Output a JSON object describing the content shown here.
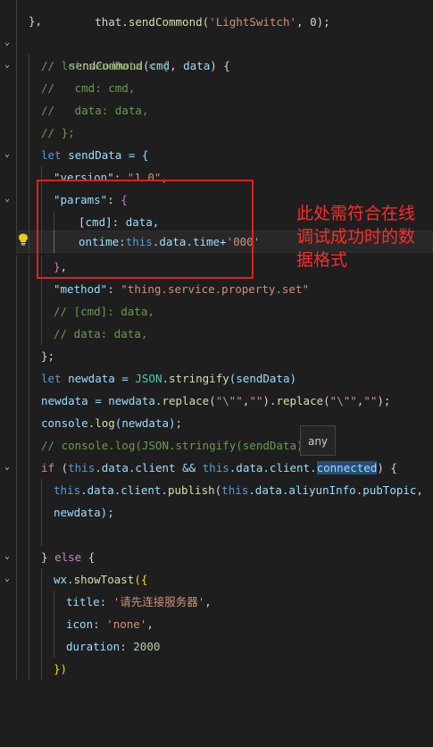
{
  "editor": {
    "tokens": {
      "l0_a": "  that.",
      "l0_b": "sendCommond",
      "l0_c": "(",
      "l0_d": "'LightSwitch'",
      "l0_e": ", 0);",
      "l1": "},",
      "l2_a": "sendCommond",
      "l2_b": "(",
      "l2_c": "cmd",
      "l2_d": ", ",
      "l2_e": "data",
      "l2_f": ") {",
      "l3": "// let sendData = {",
      "l4": "//   cmd: cmd,",
      "l5": "//   data: data,",
      "l6": "// };",
      "l7_a": "let",
      "l7_b": " sendData = {",
      "l8_a": "\"version\"",
      "l8_b": ": ",
      "l8_c": "\"1.0\"",
      "l8_d": ",",
      "l9_a": "\"params\"",
      "l9_b": ": ",
      "l9_c": "{",
      "l10_a": "[",
      "l10_b": "cmd",
      "l10_c": "]: ",
      "l10_d": "data",
      "l10_e": ",",
      "l11_a": "ontime",
      "l11_b": ":",
      "l11_c": "this",
      "l11_d": ".data.time+",
      "l11_e": "'000'",
      "l12_a": "}",
      "l12_b": ",",
      "l13_a": "\"method\"",
      "l13_b": ": ",
      "l13_c": "\"thing.service.property.set\"",
      "l14": "// [cmd]: data,",
      "l15": "// data: data,",
      "l16": "};",
      "l17_a": "let",
      "l17_b": " newdata = ",
      "l17_c": "JSON",
      "l17_d": ".",
      "l17_e": "stringify",
      "l17_f": "(sendData)",
      "l18_a": "newdata = newdata.",
      "l18_b": "replace",
      "l18_c": "(",
      "l18_d": "\"\\\"\"",
      "l18_e": ",",
      "l18_f": "\"\"",
      "l18_g": ").",
      "l18_h": "replace",
      "l18_i": "(",
      "l18_j": "\"\\\"\"",
      "l18_k": ",",
      "l18_l": "\"\"",
      "l18_m": ");",
      "l19_a": "console",
      "l19_b": ".",
      "l19_c": "log",
      "l19_d": "(newdata);",
      "l20": "// console.log(JSON.stringify(sendData));",
      "l21_a": "if",
      "l21_b": " (",
      "l21_c": "this",
      "l21_d": ".data.client && ",
      "l21_e": "this",
      "l21_f": ".data.client.",
      "l21_g": "connected",
      "l21_h": ") {",
      "l22_a": "this",
      "l22_b": ".data.client.",
      "l22_c": "publish",
      "l22_d": "(",
      "l22_e": "this",
      "l22_f": ".data.aliyunInfo.pubTopic,",
      "l23": "newdata);",
      "l25_a": "} ",
      "l25_b": "else",
      "l25_c": " {",
      "l26_a": "wx.",
      "l26_b": "showToast",
      "l26_c": "({",
      "l27_a": "title",
      "l27_b": ": ",
      "l27_c": "'请先连接服务器'",
      "l27_d": ",",
      "l28_a": "icon",
      "l28_b": ": ",
      "l28_c": "'none'",
      "l28_d": ",",
      "l29_a": "duration",
      "l29_b": ": ",
      "l29_c": "2000",
      "l30": "})"
    }
  },
  "annotation": {
    "text": "此处需符合在线调试成功时的数据格式",
    "color": "#e02020"
  },
  "tooltip": {
    "text": "any"
  },
  "icons": {
    "fold": "chevron-down-icon",
    "bulb": "lightbulb-icon"
  }
}
